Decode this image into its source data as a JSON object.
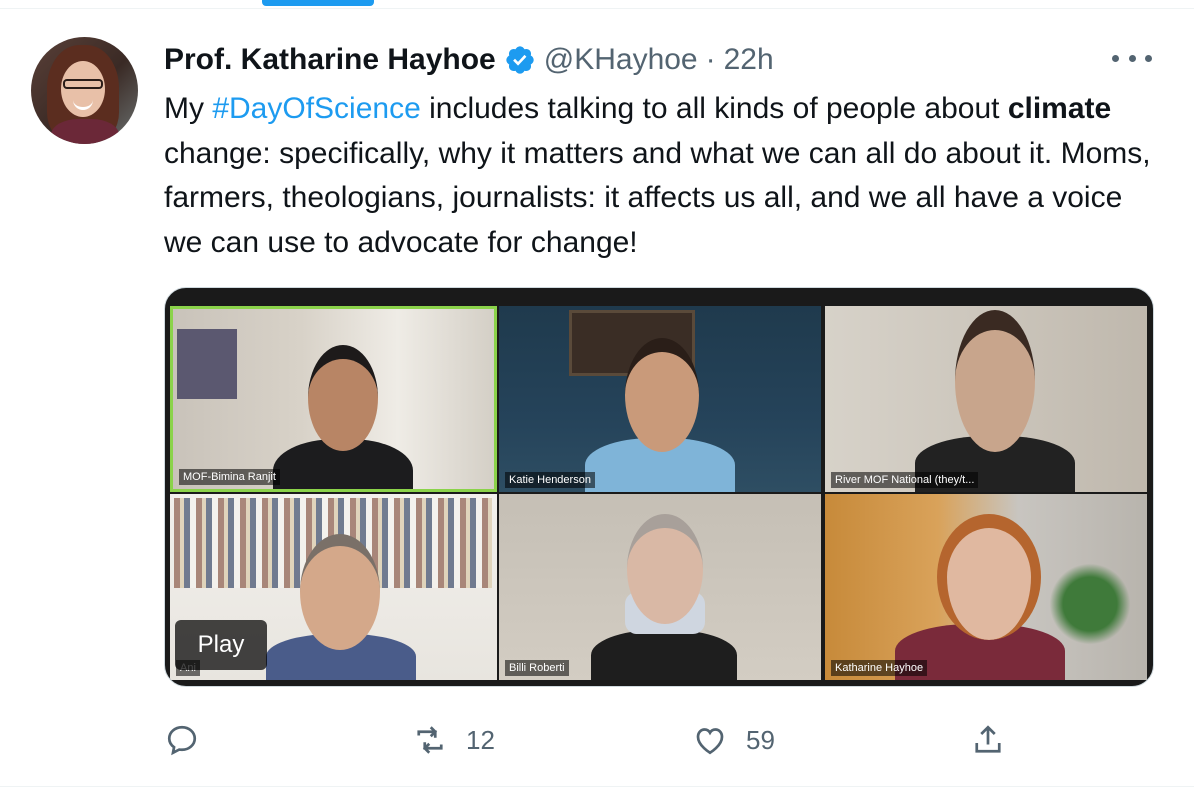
{
  "tweet": {
    "display_name": "Prof. Katharine Hayhoe",
    "handle": "@KHayhoe",
    "separator": "·",
    "time": "22h",
    "text_parts": {
      "p1": "My ",
      "hashtag": "#DayOfScience",
      "p2": " includes talking to all kinds of people about ",
      "bold": "climate",
      "p3": " change: specifically, why it matters and what we can all do about it. Moms, farmers, theologians, journalists: it affects us all, and we all have a voice we can use to advocate for change!"
    }
  },
  "video": {
    "play_label": "Play",
    "participants": [
      {
        "name": "MOF-Bimina Ranjit"
      },
      {
        "name": "Katie Henderson"
      },
      {
        "name": "River MOF National (they/t..."
      },
      {
        "name": "Ani"
      },
      {
        "name": "Billi Roberti"
      },
      {
        "name": "Katharine Hayhoe"
      }
    ]
  },
  "actions": {
    "reply_icon": "reply-icon",
    "retweet_icon": "retweet-icon",
    "retweet_count": "12",
    "like_icon": "like-icon",
    "like_count": "59",
    "share_icon": "share-icon"
  },
  "colors": {
    "accent": "#1d9bf0",
    "muted": "#536471",
    "active_speaker": "#8bd34a"
  }
}
